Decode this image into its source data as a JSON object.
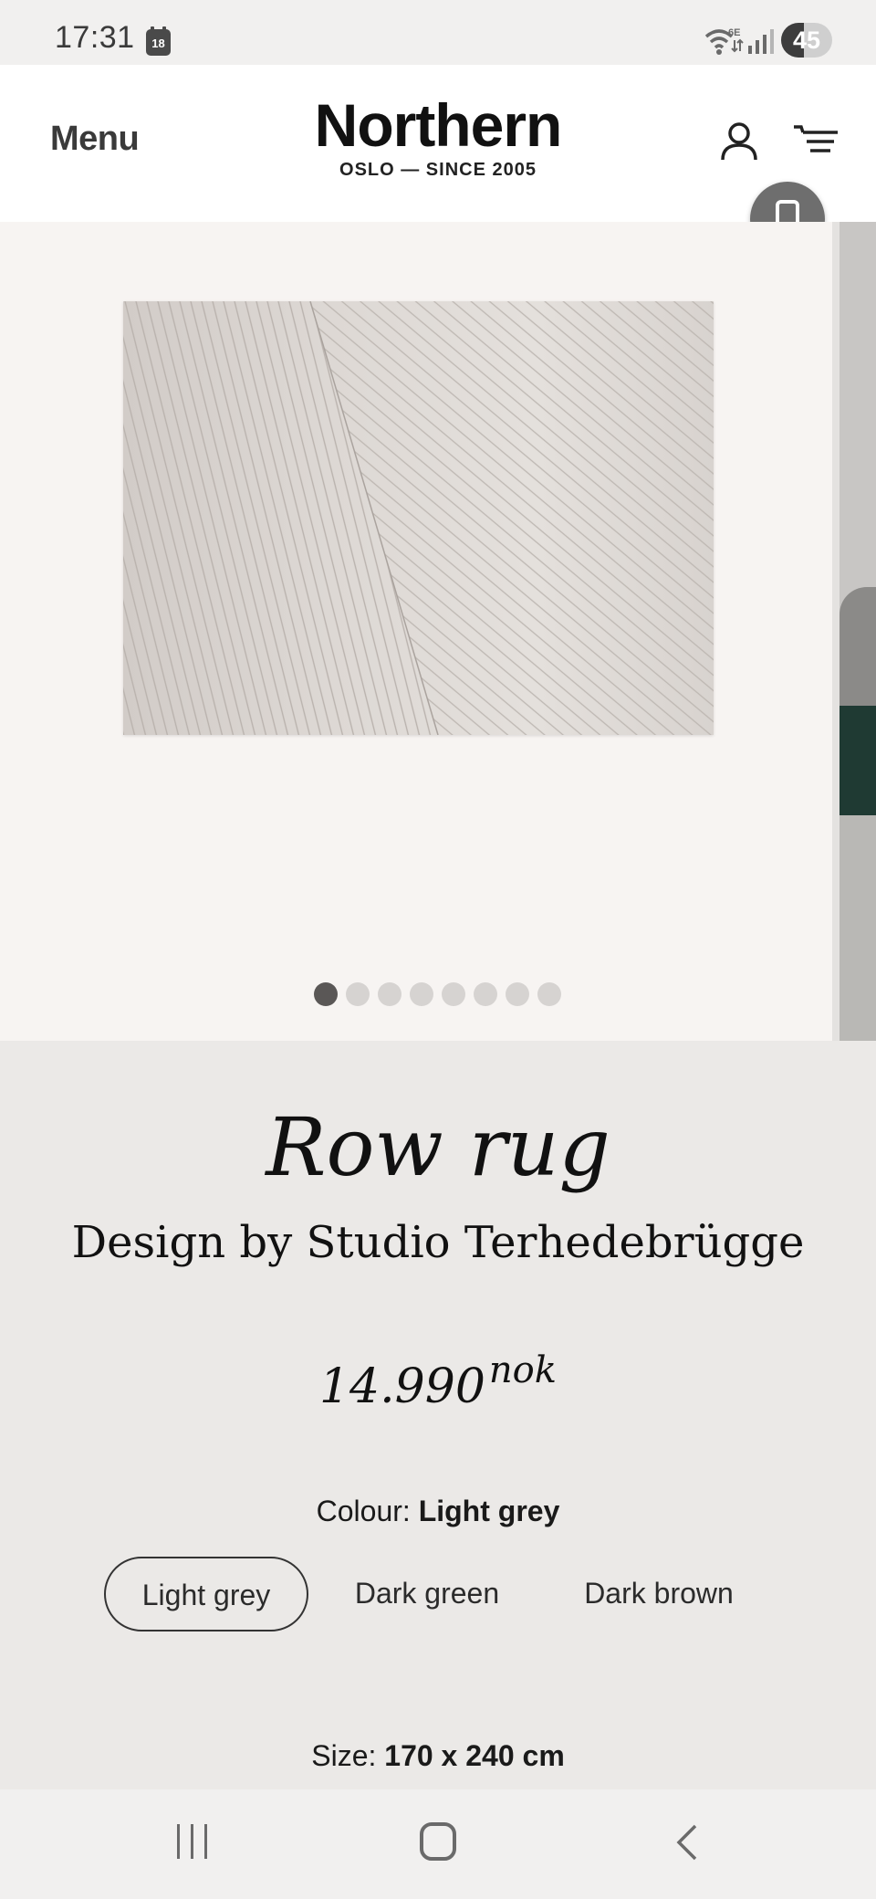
{
  "status_bar": {
    "time": "17:31",
    "calendar_day": "18",
    "network_label": "6E",
    "battery_level": 45,
    "battery_text": "45"
  },
  "header": {
    "menu_label": "Menu",
    "brand_name": "Northern",
    "brand_tagline": "OSLO — SINCE 2005",
    "icons": [
      "account-icon",
      "cart-icon",
      "device-toggle-icon"
    ]
  },
  "gallery": {
    "slide_count": 8,
    "active_index": 0
  },
  "product": {
    "title": "Row rug",
    "designer": "Design by Studio Terhedebrügge",
    "price_amount": "14.990",
    "price_currency": "nok",
    "colour_label": "Colour:",
    "colour_value": "Light grey",
    "colours": [
      {
        "label": "Light grey",
        "selected": true
      },
      {
        "label": "Dark green",
        "selected": false
      },
      {
        "label": "Dark brown",
        "selected": false
      }
    ],
    "size_label": "Size:",
    "size_value": "170 x 240 cm"
  },
  "colors": {
    "page_bg": "#ebe9e7",
    "image_bg": "#f7f4f2",
    "header_bg": "#ffffff",
    "text": "#111111",
    "dot_active": "#5a5756",
    "dot_inactive": "#d6d3d1"
  },
  "nav_bar": {
    "icons": [
      "recent-apps-icon",
      "home-icon",
      "back-icon"
    ]
  }
}
